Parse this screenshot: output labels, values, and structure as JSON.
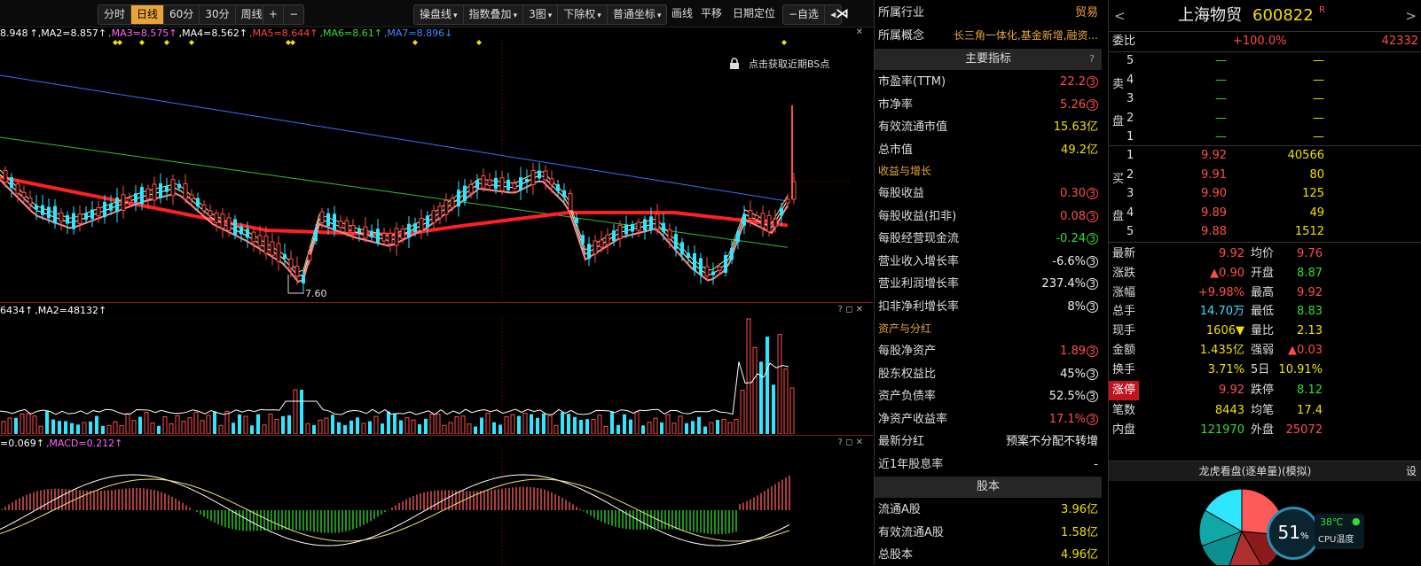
{
  "toolbar": {
    "periods": [
      "分时",
      "日线",
      "60分",
      "30分",
      "周线"
    ],
    "active_period": "日线",
    "zoom_in": "+",
    "zoom_out": "−",
    "tools": [
      "操盘线",
      "指数叠加",
      "3图",
      "下除权",
      "普通坐标"
    ],
    "plain": [
      "画线",
      "平移",
      "日期定位"
    ],
    "watchlist": "−自选",
    "nav_left": "◂",
    "nav_right": "▸",
    "nav_end": "⋊"
  },
  "chart": {
    "ma_labels": [
      {
        "text": "8.948",
        "color": "#ffffff"
      },
      {
        "text": "↑,MA2=8.857↑",
        "color": "#ffffff"
      },
      {
        "text": ",MA3=8.575↑",
        "color": "#ff66ff"
      },
      {
        "text": ",MA4=8.562↑",
        "color": "#ffffff"
      },
      {
        "text": ",MA5=8.644↑",
        "color": "#ff4444"
      },
      {
        "text": ",MA6=8.61↑",
        "color": "#33dd33"
      },
      {
        "text": ",MA7=8.896↓",
        "color": "#3a8cff"
      }
    ],
    "lock_text": "点击获取近期BS点",
    "low_label": "7.60",
    "vol_labels": [
      {
        "text": "6434↑",
        "color": "#ffffff"
      },
      {
        "text": ",MA2=48132↑",
        "color": "#ffffff"
      }
    ],
    "macd_labels": [
      {
        "text": "=0.069↑",
        "color": "#ffffff"
      },
      {
        "text": ",MACD=0.212↑",
        "color": "#ff66ff"
      }
    ],
    "pane_icons": "? ◻ ✕"
  },
  "info": {
    "industry_label": "所属行业",
    "industry_value": "贸易",
    "concept_label": "所属概念",
    "concept_value": "长三角一体化,基金新增,融资...",
    "main_header": "主要指标",
    "q_mark": "?",
    "rows_main": [
      {
        "label": "市盈率(TTM)",
        "value": "22.2",
        "color": "#ff4d4d",
        "badge": "3"
      },
      {
        "label": "市净率",
        "value": "5.26",
        "color": "#ff4d4d",
        "badge": "3"
      },
      {
        "label": "有效流通市值",
        "value": "15.63亿",
        "color": "#f0e000",
        "badge": ""
      },
      {
        "label": "总市值",
        "value": "49.2亿",
        "color": "#f0e000",
        "badge": ""
      }
    ],
    "sub1": "收益与增长",
    "rows_growth": [
      {
        "label": "每股收益",
        "value": "0.30",
        "color": "#ff4d4d",
        "badge": "3"
      },
      {
        "label": "每股收益(扣非)",
        "value": "0.08",
        "color": "#ff4d4d",
        "badge": "3"
      },
      {
        "label": "每股经营现金流",
        "value": "-0.24",
        "color": "#33dd33",
        "badge": "3"
      },
      {
        "label": "营业收入增长率",
        "value": "-6.6%",
        "color": "#eeeeee",
        "badge": "3"
      },
      {
        "label": "营业利润增长率",
        "value": "237.4%",
        "color": "#eeeeee",
        "badge": "3"
      },
      {
        "label": "扣非净利增长率",
        "value": "8%",
        "color": "#eeeeee",
        "badge": "3"
      }
    ],
    "sub2": "资产与分红",
    "rows_assets": [
      {
        "label": "每股净资产",
        "value": "1.89",
        "color": "#ff4d4d",
        "badge": "3"
      },
      {
        "label": "股东权益比",
        "value": "45%",
        "color": "#eeeeee",
        "badge": "3"
      },
      {
        "label": "资产负债率",
        "value": "52.5%",
        "color": "#eeeeee",
        "badge": "3"
      },
      {
        "label": "净资产收益率",
        "value": "17.1%",
        "color": "#ff4d4d",
        "badge": "3"
      },
      {
        "label": "最新分红",
        "value": "预案不分配不转增",
        "color": "#eeeeee",
        "badge": ""
      },
      {
        "label": "近1年股息率",
        "value": "-",
        "color": "#eeeeee",
        "badge": ""
      }
    ],
    "equity_header": "股本",
    "rows_equity": [
      {
        "label": "流通A股",
        "value": "3.96亿",
        "color": "#f0e000",
        "badge": ""
      },
      {
        "label": "有效流通A股",
        "value": "1.58亿",
        "color": "#f0e000",
        "badge": ""
      },
      {
        "label": "总股本",
        "value": "4.96亿",
        "color": "#f0e000",
        "badge": ""
      }
    ]
  },
  "quote": {
    "nav_prev": "<",
    "nav_next": ">",
    "stock_name": "上海物贸",
    "stock_code": "600822",
    "tag": "R",
    "weibi_label": "委比",
    "weibi_value": "+100.0%",
    "weibi_volume": "42332",
    "sell_label": [
      "卖",
      "盘"
    ],
    "buy_label": [
      "买",
      "盘"
    ],
    "sell_rows": [
      {
        "level": "5",
        "price": "—",
        "vol": "—"
      },
      {
        "level": "4",
        "price": "—",
        "vol": "—"
      },
      {
        "level": "3",
        "price": "—",
        "vol": "—"
      },
      {
        "level": "2",
        "price": "—",
        "vol": "—"
      },
      {
        "level": "1",
        "price": "—",
        "vol": "—"
      }
    ],
    "buy_rows": [
      {
        "level": "1",
        "price": "9.92",
        "vol": "40566"
      },
      {
        "level": "2",
        "price": "9.91",
        "vol": "80"
      },
      {
        "level": "3",
        "price": "9.90",
        "vol": "125"
      },
      {
        "level": "4",
        "price": "9.89",
        "vol": "49"
      },
      {
        "level": "5",
        "price": "9.88",
        "vol": "1512"
      }
    ],
    "stats": [
      {
        "l1": "最新",
        "v1": "9.92",
        "c1": "#ff4d4d",
        "l2": "均价",
        "v2": "9.76",
        "c2": "#ff4d4d"
      },
      {
        "l1": "涨跌",
        "v1": "▲0.90",
        "c1": "#ff4d4d",
        "l2": "开盘",
        "v2": "8.87",
        "c2": "#33dd33"
      },
      {
        "l1": "涨幅",
        "v1": "+9.98%",
        "c1": "#ff4d4d",
        "l2": "最高",
        "v2": "9.92",
        "c2": "#ff4d4d"
      },
      {
        "l1": "总手",
        "v1": "14.70万",
        "c1": "#2ee6ff",
        "l2": "最低",
        "v2": "8.83",
        "c2": "#33dd33"
      },
      {
        "l1": "现手",
        "v1": "1606▼",
        "c1": "#f0e000",
        "l2": "量比",
        "v2": "2.13",
        "c2": "#f0e000"
      },
      {
        "l1": "金额",
        "v1": "1.435亿",
        "c1": "#f0e000",
        "l2": "强弱",
        "v2": "▲0.03",
        "c2": "#ff4d4d"
      },
      {
        "l1": "换手",
        "v1": "3.71%",
        "c1": "#f0e000",
        "l2": "5日",
        "v2": "10.91%",
        "c2": "#f0e000"
      }
    ],
    "limit_row": {
      "l1": "涨停",
      "v1": "9.92",
      "l2": "跌停",
      "v2": "8.12"
    },
    "stats2": [
      {
        "l1": "笔数",
        "v1": "8443",
        "c1": "#f0e000",
        "l2": "均笔",
        "v2": "17.4",
        "c2": "#f0e000"
      },
      {
        "l1": "内盘",
        "v1": "121970",
        "c1": "#33dd33",
        "l2": "外盘",
        "v2": "25072",
        "c2": "#ff4d4d"
      }
    ],
    "dragon_header": "龙虎看盘(逐单量)(模拟)",
    "settings": "设",
    "cpu_percent": "51",
    "cpu_unit": "%",
    "cpu_temp": "38℃",
    "cpu_label": "CPU温度"
  }
}
